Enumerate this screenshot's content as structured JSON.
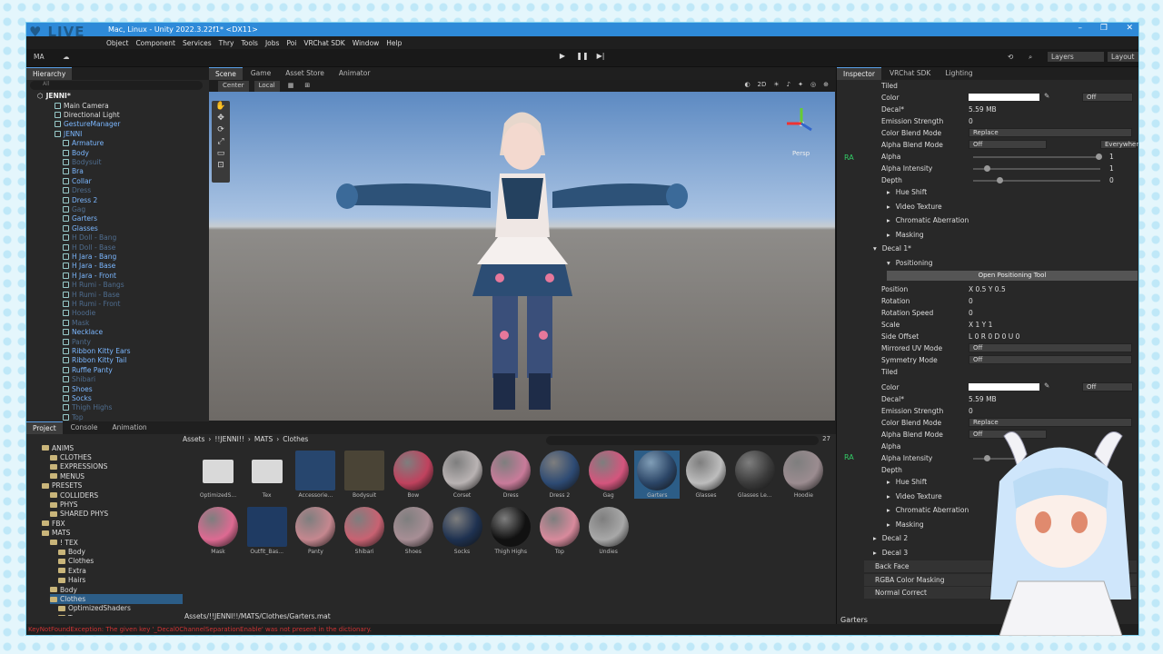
{
  "overlay": {
    "live_label": "LIVE"
  },
  "window": {
    "title": "Mac, Linux - Unity 2022.3.22f1* <DX11>",
    "controls": [
      "–",
      "❐",
      "✕"
    ]
  },
  "menu": [
    "Object",
    "Component",
    "Services",
    "Thry",
    "Tools",
    "Jobs",
    "Poi",
    "VRChat SDK",
    "Window",
    "Help"
  ],
  "toolbar": {
    "account": "MA",
    "layers": "Layers",
    "layout": "Layout"
  },
  "hierarchy": {
    "tab": "Hierarchy",
    "search_placeholder": "All",
    "scene": "JENNI*",
    "rows": [
      {
        "label": "Main Camera",
        "cls": "white",
        "indent": 1
      },
      {
        "label": "Directional Light",
        "cls": "white",
        "indent": 1
      },
      {
        "label": "GestureManager",
        "cls": "blue",
        "indent": 1
      },
      {
        "label": "JENNI",
        "cls": "blue",
        "indent": 1
      },
      {
        "label": "Armature",
        "cls": "blue",
        "indent": 2
      },
      {
        "label": "Body",
        "cls": "blue",
        "indent": 2
      },
      {
        "label": "Bodysuit",
        "cls": "faded",
        "indent": 2
      },
      {
        "label": "Bra",
        "cls": "blue",
        "indent": 2
      },
      {
        "label": "Collar",
        "cls": "blue",
        "indent": 2
      },
      {
        "label": "Dress",
        "cls": "faded",
        "indent": 2
      },
      {
        "label": "Dress 2",
        "cls": "blue",
        "indent": 2
      },
      {
        "label": "Gag",
        "cls": "faded",
        "indent": 2
      },
      {
        "label": "Garters",
        "cls": "blue",
        "indent": 2
      },
      {
        "label": "Glasses",
        "cls": "blue",
        "indent": 2
      },
      {
        "label": "H Doll - Bang",
        "cls": "faded",
        "indent": 2
      },
      {
        "label": "H Doll - Base",
        "cls": "faded",
        "indent": 2
      },
      {
        "label": "H Jara - Bang",
        "cls": "blue",
        "indent": 2
      },
      {
        "label": "H Jara - Base",
        "cls": "blue",
        "indent": 2
      },
      {
        "label": "H Jara - Front",
        "cls": "blue",
        "indent": 2
      },
      {
        "label": "H Rumi - Bangs",
        "cls": "faded",
        "indent": 2
      },
      {
        "label": "H Rumi - Base",
        "cls": "faded",
        "indent": 2
      },
      {
        "label": "H Rumi - Front",
        "cls": "faded",
        "indent": 2
      },
      {
        "label": "Hoodie",
        "cls": "faded",
        "indent": 2
      },
      {
        "label": "Mask",
        "cls": "faded",
        "indent": 2
      },
      {
        "label": "Necklace",
        "cls": "blue",
        "indent": 2
      },
      {
        "label": "Panty",
        "cls": "faded",
        "indent": 2
      },
      {
        "label": "Ribbon Kitty Ears",
        "cls": "blue",
        "indent": 2
      },
      {
        "label": "Ribbon Kitty Tail",
        "cls": "blue",
        "indent": 2
      },
      {
        "label": "Ruffle Panty",
        "cls": "blue",
        "indent": 2
      },
      {
        "label": "Shibari",
        "cls": "faded",
        "indent": 2
      },
      {
        "label": "Shoes",
        "cls": "blue",
        "indent": 2
      },
      {
        "label": "Socks",
        "cls": "blue",
        "indent": 2
      },
      {
        "label": "Thigh Highs",
        "cls": "faded",
        "indent": 2
      },
      {
        "label": "Top",
        "cls": "faded",
        "indent": 2
      }
    ]
  },
  "scene_tabs": [
    "Scene",
    "Game",
    "Asset Store",
    "Animator"
  ],
  "scene_toolbar": {
    "pivot": "Center",
    "space": "Local",
    "mode2d": "2D",
    "persp": "Persp"
  },
  "project": {
    "tabs": [
      "Project",
      "Console",
      "Animation"
    ],
    "breadcrumb": [
      "Assets",
      "!!JENNI!!",
      "MATS",
      "Clothes"
    ],
    "count": "27",
    "tree": [
      {
        "label": "ANIMS",
        "indent": 1
      },
      {
        "label": "CLOTHES",
        "indent": 2
      },
      {
        "label": "EXPRESSIONS",
        "indent": 2
      },
      {
        "label": "MENUS",
        "indent": 2
      },
      {
        "label": "PRESETS",
        "indent": 1
      },
      {
        "label": "COLLIDERS",
        "indent": 2
      },
      {
        "label": "PHYS",
        "indent": 2
      },
      {
        "label": "SHARED PHYS",
        "indent": 2
      },
      {
        "label": "FBX",
        "indent": 1
      },
      {
        "label": "MATS",
        "indent": 1
      },
      {
        "label": "! TEX",
        "indent": 2
      },
      {
        "label": "Body",
        "indent": 3
      },
      {
        "label": "Clothes",
        "indent": 3
      },
      {
        "label": "Extra",
        "indent": 3
      },
      {
        "label": "Hairs",
        "indent": 3
      },
      {
        "label": "Body",
        "indent": 2
      },
      {
        "label": "Clothes",
        "indent": 2
      },
      {
        "label": "OptimizedShaders",
        "indent": 3
      },
      {
        "label": "Tex",
        "indent": 3
      }
    ],
    "assets": [
      {
        "label": "OptimizedS...",
        "kind": "folder",
        "color": "#d9d9d9"
      },
      {
        "label": "Tex",
        "kind": "folder",
        "color": "#d9d9d9"
      },
      {
        "label": "Accessorie...",
        "kind": "tex",
        "color": "#27466e"
      },
      {
        "label": "Bodysuit",
        "kind": "tex",
        "color": "#4a4436"
      },
      {
        "label": "Bow",
        "kind": "mat",
        "color": "#c0425e"
      },
      {
        "label": "Corset",
        "kind": "mat",
        "color": "#b9b3b3"
      },
      {
        "label": "Dress",
        "kind": "mat",
        "color": "#c97b9a"
      },
      {
        "label": "Dress 2",
        "kind": "mat",
        "color": "#2d4a73"
      },
      {
        "label": "Gag",
        "kind": "mat",
        "color": "#d4557d"
      },
      {
        "label": "Garters",
        "kind": "mat",
        "color": "#2b4566"
      },
      {
        "label": "Glasses",
        "kind": "mat",
        "color": "#bdbdbd"
      },
      {
        "label": "Glasses Le...",
        "kind": "mat",
        "color": "#3a3a3a"
      },
      {
        "label": "Hoodie",
        "kind": "mat",
        "color": "#9b8c90"
      },
      {
        "label": "Mask",
        "kind": "mat",
        "color": "#dd6a92"
      },
      {
        "label": "Outfit_Bas...",
        "kind": "tex",
        "color": "#1f3b63"
      },
      {
        "label": "Panty",
        "kind": "mat",
        "color": "#c5878f"
      },
      {
        "label": "Shibari",
        "kind": "mat",
        "color": "#c86272"
      },
      {
        "label": "Shoes",
        "kind": "mat",
        "color": "#a78e95"
      },
      {
        "label": "Socks",
        "kind": "mat",
        "color": "#1e3150"
      },
      {
        "label": "Thigh Highs",
        "kind": "mat",
        "color": "#111111"
      },
      {
        "label": "Top",
        "kind": "mat",
        "color": "#d88a9c"
      },
      {
        "label": "Undies",
        "kind": "mat",
        "color": "#a8a8a8"
      }
    ],
    "path": "Assets/!!JENNI!!/MATS/Clothes/Garters.mat"
  },
  "inspector": {
    "tabs": [
      "Inspector",
      "VRChat SDK",
      "Lighting"
    ],
    "footer": "Garters",
    "ra": "RA",
    "rows": [
      {
        "label": "Tiled",
        "val": "",
        "type": "text"
      },
      {
        "label": "Color",
        "val": "Off",
        "type": "color"
      },
      {
        "label": "Decal*",
        "val": "5.59 MB",
        "type": "tex"
      },
      {
        "label": "Emission Strength",
        "val": "0",
        "type": "slider"
      },
      {
        "label": "Color Blend Mode",
        "val": "Replace",
        "type": "dd"
      },
      {
        "label": "Alpha Blend Mode",
        "val": "Off",
        "type": "dd2",
        "val2": "Everywhere"
      },
      {
        "label": "Alpha",
        "val": "1",
        "type": "slider2"
      },
      {
        "label": "Alpha Intensity",
        "val": "1",
        "type": "slider3"
      },
      {
        "label": "Depth",
        "val": "0",
        "type": "slider4"
      }
    ],
    "sections1": [
      "Hue Shift",
      "Video Texture",
      "Chromatic Aberration",
      "Masking"
    ],
    "decal1": "Decal 1*",
    "positioning": "Positioning",
    "open_tool": "Open Positioning Tool",
    "pos_rows": [
      {
        "label": "Position",
        "val": "X  0.5            Y  0.5"
      },
      {
        "label": "Rotation",
        "val": "0"
      },
      {
        "label": "Rotation Speed",
        "val": "0"
      },
      {
        "label": "Scale",
        "val": "X  1                    Y  1"
      },
      {
        "label": "Side Offset",
        "val": "L  0      R  0      D  0      U  0"
      },
      {
        "label": "Mirrored UV Mode",
        "val": "Off"
      },
      {
        "label": "Symmetry Mode",
        "val": "Off"
      },
      {
        "label": "Tiled",
        "val": ""
      }
    ],
    "rows2": [
      {
        "label": "Color",
        "val": "Off"
      },
      {
        "label": "Decal*",
        "val": "5.59 MB"
      },
      {
        "label": "Emission Strength",
        "val": "0"
      },
      {
        "label": "Color Blend Mode",
        "val": "Replace"
      },
      {
        "label": "Alpha Blend Mode",
        "val": "Off"
      },
      {
        "label": "Alpha",
        "val": ""
      },
      {
        "label": "Alpha Intensity",
        "val": ""
      },
      {
        "label": "Depth",
        "val": ""
      }
    ],
    "sections2": [
      "Hue Shift",
      "Video Texture",
      "Chromatic Aberration",
      "Masking"
    ],
    "decals": [
      "Decal 2",
      "Decal 3"
    ],
    "bottom": [
      "Back Face",
      "RGBA Color Masking",
      "Normal Correct"
    ]
  },
  "status": "KeyNotFoundException: The given key '_Decal0ChannelSeparationEnable' was not present in the dictionary."
}
